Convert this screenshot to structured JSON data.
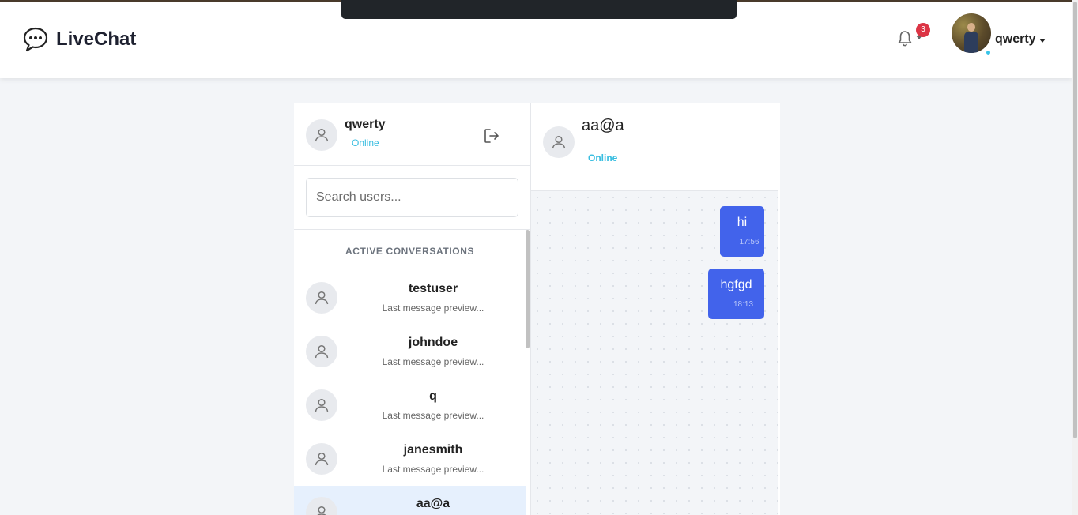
{
  "app": {
    "brand": "LiveChat"
  },
  "toast": {
    "text": ""
  },
  "navbar": {
    "notification_count": "3",
    "username": "qwerty"
  },
  "sidebar": {
    "current_user": {
      "name": "qwerty",
      "status": "Online"
    },
    "search_placeholder": "Search users...",
    "section_title": "ACTIVE CONVERSATIONS",
    "conversations": [
      {
        "name": "testuser",
        "preview": "Last message preview..."
      },
      {
        "name": "johndoe",
        "preview": "Last message preview..."
      },
      {
        "name": "q",
        "preview": "Last message preview..."
      },
      {
        "name": "janesmith",
        "preview": "Last message preview..."
      },
      {
        "name": "aa@a",
        "preview": "",
        "active": true
      }
    ]
  },
  "chat": {
    "contact_name": "aa@a",
    "contact_status": "Online",
    "messages": [
      {
        "text": "hi",
        "time": "17:56",
        "outgoing": true
      },
      {
        "text": "hgfgd",
        "time": "18:13",
        "outgoing": true
      }
    ]
  },
  "colors": {
    "accent": "#4263eb",
    "online": "#38bde0",
    "badge": "#dc3545",
    "active_row": "#e6f0fd"
  },
  "icons": [
    "chat-bubble-icon",
    "bell-icon",
    "user-icon",
    "logout-icon"
  ]
}
